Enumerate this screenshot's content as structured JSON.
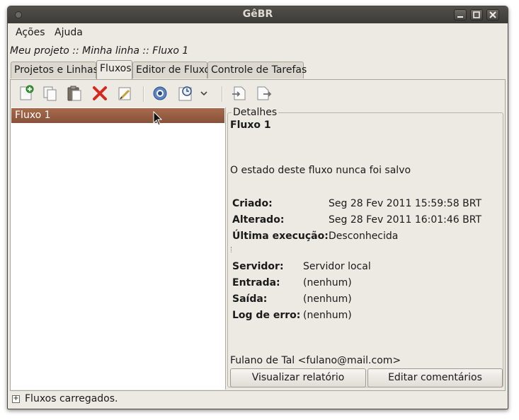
{
  "window": {
    "title": "GêBR"
  },
  "menubar": {
    "items": [
      {
        "label": "Ações"
      },
      {
        "label": "Ajuda"
      }
    ]
  },
  "breadcrumb": "Meu projeto :: Minha linha :: Fluxo 1",
  "tabs": [
    {
      "label": "Projetos e Linhas"
    },
    {
      "label": "Fluxos"
    },
    {
      "label": "Editor de Fluxo"
    },
    {
      "label": "Controle de Tarefas"
    }
  ],
  "active_tab": "Fluxos",
  "toolbar": {
    "icons": [
      "new-flow-icon",
      "copy-icon",
      "paste-icon",
      "delete-icon",
      "edit-icon",
      "run-icon",
      "schedule-icon",
      "dropdown-chevron-icon",
      "import-icon",
      "export-icon"
    ]
  },
  "flow_list": {
    "items": [
      {
        "label": "Fluxo 1",
        "selected": true
      }
    ]
  },
  "details": {
    "legend": "Detalhes",
    "title": "Fluxo 1",
    "state": "O estado deste fluxo nunca foi salvo",
    "created_label": "Criado:",
    "created_value": "Seg 28 Fev 2011 15:59:58 BRT",
    "modified_label": "Alterado:",
    "modified_value": "Seg 28 Fev 2011 16:01:46 BRT",
    "last_run_label": "Última execução:",
    "last_run_value": "Desconhecida",
    "server_label": "Servidor:",
    "server_value": "Servidor local",
    "input_label": "Entrada:",
    "input_value": "(nenhum)",
    "output_label": "Saída:",
    "output_value": "(nenhum)",
    "error_log_label": "Log de erro:",
    "error_log_value": "(nenhum)",
    "author": "Fulano de Tal <fulano@mail.com>",
    "view_report_button": "Visualizar relatório",
    "edit_comments_button": "Editar comentários"
  },
  "statusbar": {
    "text": "Fluxos carregados."
  },
  "colors": {
    "selection": "#87513a",
    "titlebar": "#3c3b37",
    "window_bg": "#ede9e3",
    "delete": "#d42a1e"
  }
}
